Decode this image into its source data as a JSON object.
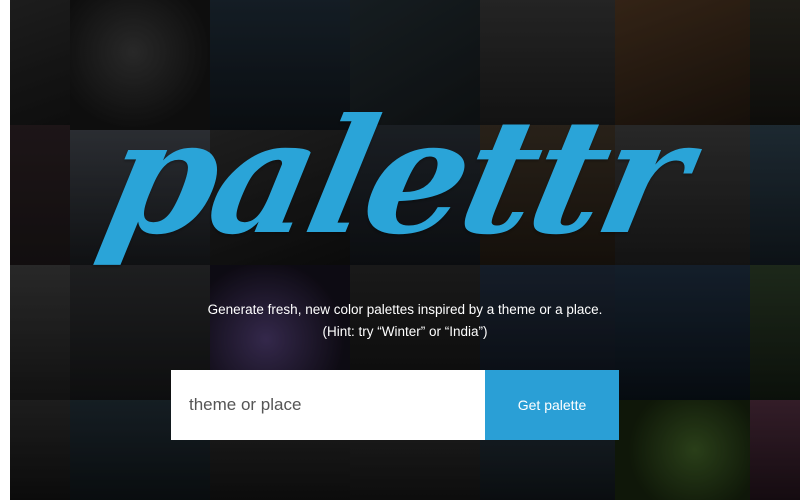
{
  "brand": {
    "logo_text": "palettr",
    "accent_color": "#2aa4d8"
  },
  "hero": {
    "tagline": "Generate fresh, new color palettes inspired by a theme or a place.",
    "hint": "(Hint: try “Winter” or “India”)"
  },
  "search": {
    "placeholder": "theme or place",
    "value": ""
  },
  "actions": {
    "get_palette_label": "Get palette",
    "button_color": "#2a9fd6"
  },
  "background": {
    "description": "mosaic of dark photos"
  }
}
